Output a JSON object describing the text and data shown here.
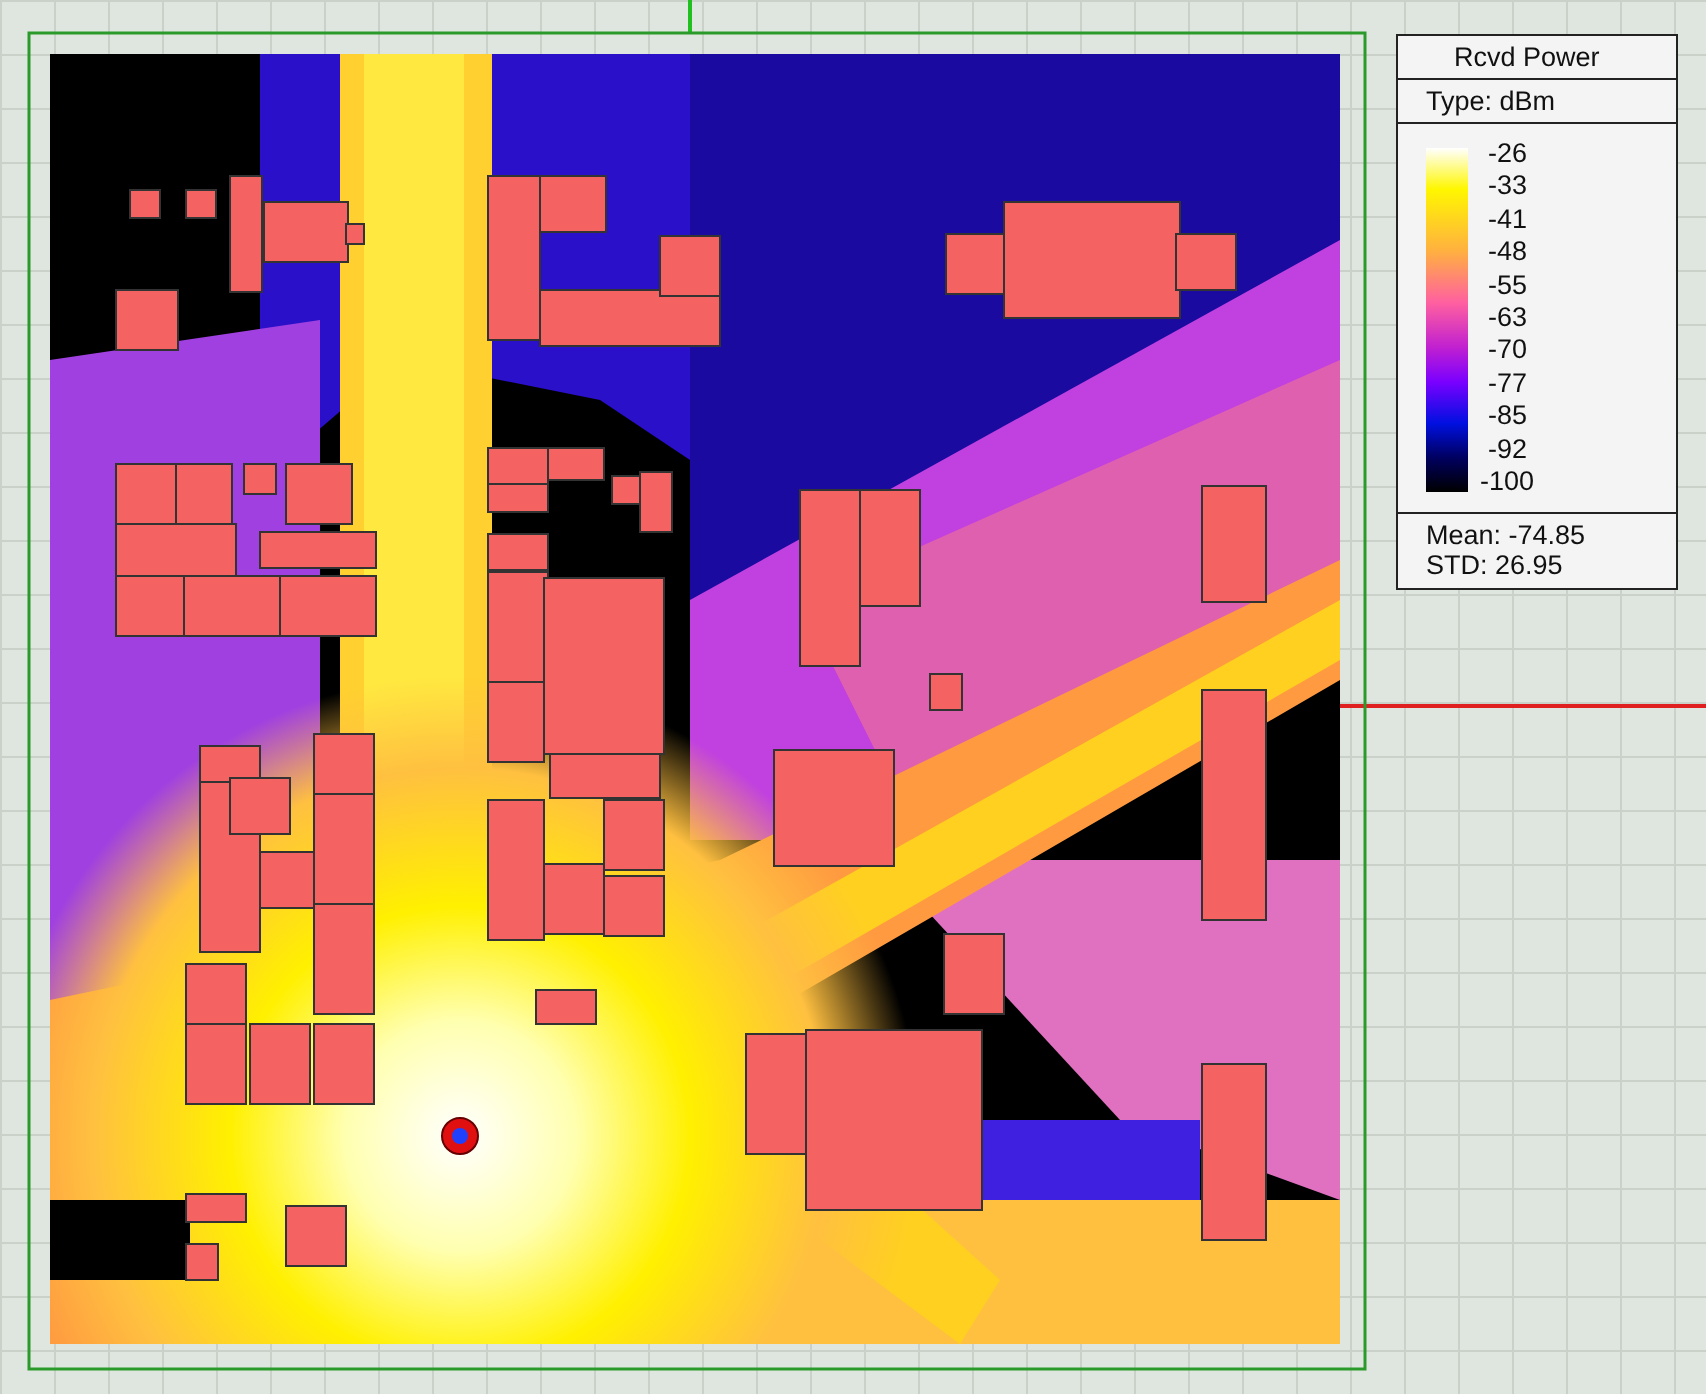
{
  "legend": {
    "title": "Rcvd Power",
    "type_label": "Type: dBm",
    "ticks": [
      "-26",
      "-33",
      "-41",
      "-48",
      "-55",
      "-63",
      "-70",
      "-77",
      "-85",
      "-92",
      "-100"
    ],
    "mean": "Mean: -74.85",
    "std": "STD: 26.95"
  }
}
